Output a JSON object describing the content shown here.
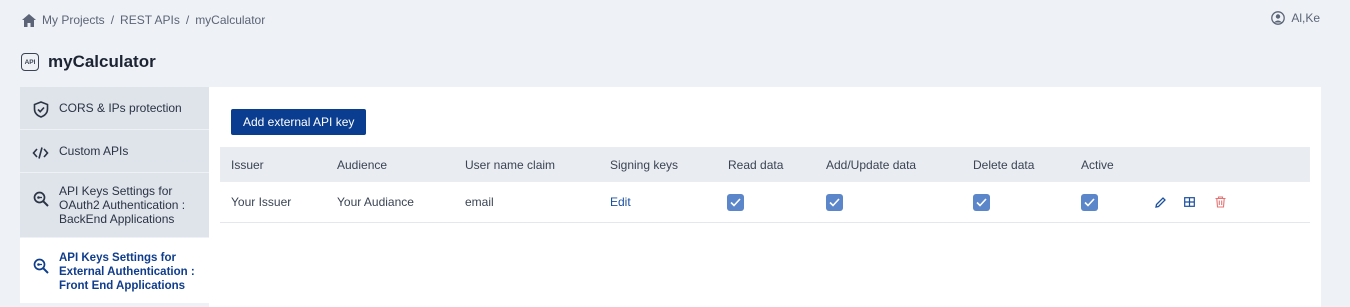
{
  "breadcrumb": [
    "My Projects",
    "REST APIs",
    "myCalculator"
  ],
  "user": {
    "name": "Al,Ke"
  },
  "page": {
    "badge": "API",
    "title": "myCalculator"
  },
  "sidebar": {
    "items": [
      {
        "label": "CORS & IPs protection",
        "icon": "shield-check-icon"
      },
      {
        "label": "Custom APIs",
        "icon": "code-icon"
      },
      {
        "label": "API Keys Settings for OAuth2 Authentication : BackEnd Applications",
        "icon": "key-search-icon"
      },
      {
        "label": "API Keys Settings for External Authentication : Front End Applications",
        "icon": "key-search-icon",
        "active": true
      }
    ]
  },
  "main": {
    "add_button": "Add external API key",
    "columns": [
      "Issuer",
      "Audience",
      "User name claim",
      "Signing keys",
      "Read data",
      "Add/Update data",
      "Delete data",
      "Active"
    ],
    "rows": [
      {
        "issuer": "Your Issuer",
        "audience": "Your Audiance",
        "claim": "email",
        "signing_keys": "Edit",
        "read": true,
        "add_update": true,
        "delete": true,
        "active": true
      }
    ]
  },
  "colors": {
    "primary": "#0a3d8f",
    "checkbox": "#5b86c9",
    "delete": "#e57373",
    "edit": "#1b4fa0"
  }
}
